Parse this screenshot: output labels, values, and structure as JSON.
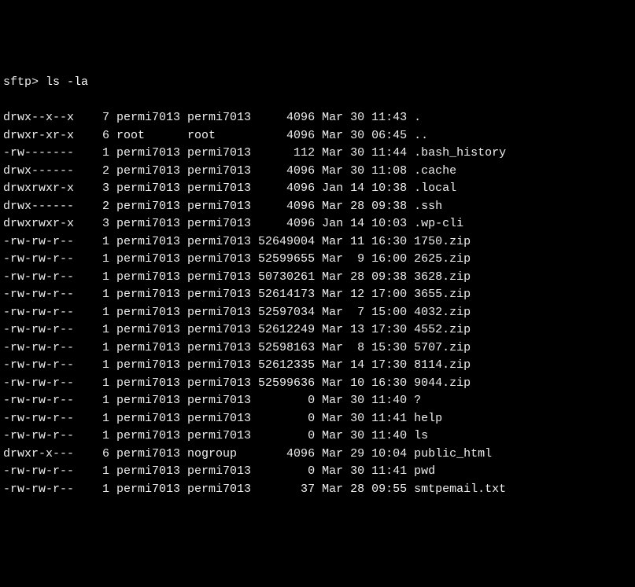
{
  "prompt": "sftp>",
  "command": "ls -la",
  "rows": [
    {
      "perm": "drwx--x--x",
      "links": "7",
      "owner": "permi7013",
      "group": "permi7013",
      "size": "4096",
      "month": "Mar",
      "day": "30",
      "time": "11:43",
      "name": "."
    },
    {
      "perm": "drwxr-xr-x",
      "links": "6",
      "owner": "root",
      "group": "root",
      "size": "4096",
      "month": "Mar",
      "day": "30",
      "time": "06:45",
      "name": ".."
    },
    {
      "perm": "-rw-------",
      "links": "1",
      "owner": "permi7013",
      "group": "permi7013",
      "size": "112",
      "month": "Mar",
      "day": "30",
      "time": "11:44",
      "name": ".bash_history"
    },
    {
      "perm": "drwx------",
      "links": "2",
      "owner": "permi7013",
      "group": "permi7013",
      "size": "4096",
      "month": "Mar",
      "day": "30",
      "time": "11:08",
      "name": ".cache"
    },
    {
      "perm": "drwxrwxr-x",
      "links": "3",
      "owner": "permi7013",
      "group": "permi7013",
      "size": "4096",
      "month": "Jan",
      "day": "14",
      "time": "10:38",
      "name": ".local"
    },
    {
      "perm": "drwx------",
      "links": "2",
      "owner": "permi7013",
      "group": "permi7013",
      "size": "4096",
      "month": "Mar",
      "day": "28",
      "time": "09:38",
      "name": ".ssh"
    },
    {
      "perm": "drwxrwxr-x",
      "links": "3",
      "owner": "permi7013",
      "group": "permi7013",
      "size": "4096",
      "month": "Jan",
      "day": "14",
      "time": "10:03",
      "name": ".wp-cli"
    },
    {
      "perm": "-rw-rw-r--",
      "links": "1",
      "owner": "permi7013",
      "group": "permi7013",
      "size": "52649004",
      "month": "Mar",
      "day": "11",
      "time": "16:30",
      "name": "1750.zip"
    },
    {
      "perm": "-rw-rw-r--",
      "links": "1",
      "owner": "permi7013",
      "group": "permi7013",
      "size": "52599655",
      "month": "Mar",
      "day": "9",
      "time": "16:00",
      "name": "2625.zip"
    },
    {
      "perm": "-rw-rw-r--",
      "links": "1",
      "owner": "permi7013",
      "group": "permi7013",
      "size": "50730261",
      "month": "Mar",
      "day": "28",
      "time": "09:38",
      "name": "3628.zip"
    },
    {
      "perm": "-rw-rw-r--",
      "links": "1",
      "owner": "permi7013",
      "group": "permi7013",
      "size": "52614173",
      "month": "Mar",
      "day": "12",
      "time": "17:00",
      "name": "3655.zip"
    },
    {
      "perm": "-rw-rw-r--",
      "links": "1",
      "owner": "permi7013",
      "group": "permi7013",
      "size": "52597034",
      "month": "Mar",
      "day": "7",
      "time": "15:00",
      "name": "4032.zip"
    },
    {
      "perm": "-rw-rw-r--",
      "links": "1",
      "owner": "permi7013",
      "group": "permi7013",
      "size": "52612249",
      "month": "Mar",
      "day": "13",
      "time": "17:30",
      "name": "4552.zip"
    },
    {
      "perm": "-rw-rw-r--",
      "links": "1",
      "owner": "permi7013",
      "group": "permi7013",
      "size": "52598163",
      "month": "Mar",
      "day": "8",
      "time": "15:30",
      "name": "5707.zip"
    },
    {
      "perm": "-rw-rw-r--",
      "links": "1",
      "owner": "permi7013",
      "group": "permi7013",
      "size": "52612335",
      "month": "Mar",
      "day": "14",
      "time": "17:30",
      "name": "8114.zip"
    },
    {
      "perm": "-rw-rw-r--",
      "links": "1",
      "owner": "permi7013",
      "group": "permi7013",
      "size": "52599636",
      "month": "Mar",
      "day": "10",
      "time": "16:30",
      "name": "9044.zip"
    },
    {
      "perm": "-rw-rw-r--",
      "links": "1",
      "owner": "permi7013",
      "group": "permi7013",
      "size": "0",
      "month": "Mar",
      "day": "30",
      "time": "11:40",
      "name": "?"
    },
    {
      "perm": "-rw-rw-r--",
      "links": "1",
      "owner": "permi7013",
      "group": "permi7013",
      "size": "0",
      "month": "Mar",
      "day": "30",
      "time": "11:41",
      "name": "help"
    },
    {
      "perm": "-rw-rw-r--",
      "links": "1",
      "owner": "permi7013",
      "group": "permi7013",
      "size": "0",
      "month": "Mar",
      "day": "30",
      "time": "11:40",
      "name": "ls"
    },
    {
      "perm": "drwxr-x---",
      "links": "6",
      "owner": "permi7013",
      "group": "nogroup",
      "size": "4096",
      "month": "Mar",
      "day": "29",
      "time": "10:04",
      "name": "public_html"
    },
    {
      "perm": "-rw-rw-r--",
      "links": "1",
      "owner": "permi7013",
      "group": "permi7013",
      "size": "0",
      "month": "Mar",
      "day": "30",
      "time": "11:41",
      "name": "pwd"
    },
    {
      "perm": "-rw-rw-r--",
      "links": "1",
      "owner": "permi7013",
      "group": "permi7013",
      "size": "37",
      "month": "Mar",
      "day": "28",
      "time": "09:55",
      "name": "smtpemail.txt"
    }
  ]
}
